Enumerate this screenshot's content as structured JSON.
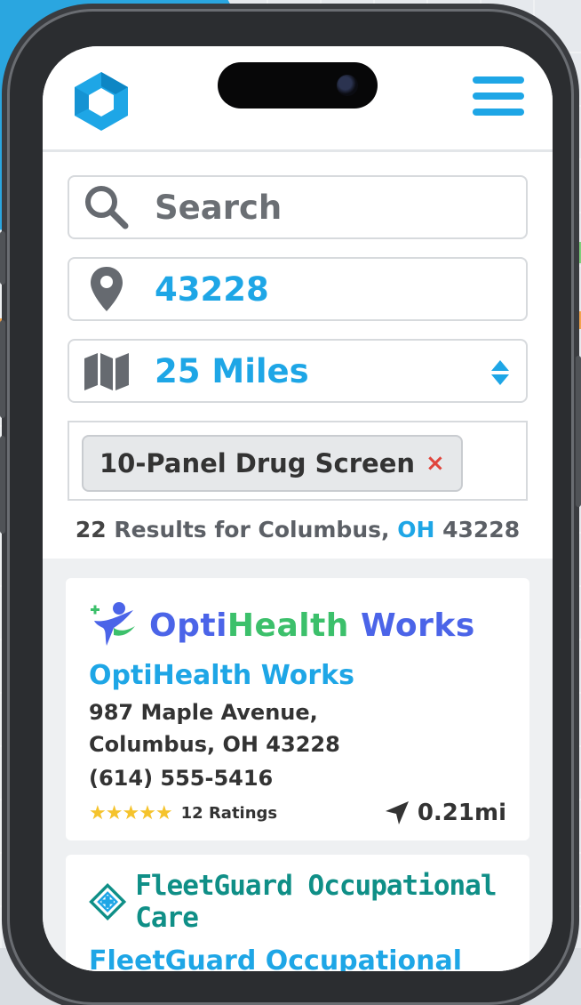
{
  "search": {
    "placeholder": "Search"
  },
  "location": {
    "value": "43228"
  },
  "radius": {
    "value": "25 Miles"
  },
  "filter_tag": {
    "label": "10-Panel Drug Screen",
    "remove": "×"
  },
  "results_summary": {
    "count": "22",
    "text": "Results for Columbus,",
    "state": "OH",
    "zip": "43228"
  },
  "results": [
    {
      "logo_word_part1": "Opti",
      "logo_word_part2": "Health",
      "logo_word_part3": " Works",
      "name": "OptiHealth Works",
      "address_line1": "987 Maple Avenue,",
      "address_line2": "Columbus, OH 43228",
      "phone": "(614) 555-5416",
      "rating_stars": 5,
      "ratings_text": "12 Ratings",
      "distance": "0.21mi"
    },
    {
      "logo_word": "FleetGuard Occupational Care",
      "name": "FleetGuard Occupational Care"
    }
  ],
  "colors": {
    "accent": "#1ea6e6",
    "opti_blue": "#4b64e8",
    "opti_green": "#3cc06b",
    "fleet_teal": "#0f8f87",
    "star": "#f5c32c"
  },
  "icons": {
    "logo": "hexagon-logo-icon",
    "menu": "hamburger-menu-icon",
    "search": "search-icon",
    "location": "map-pin-icon",
    "radius": "map-icon",
    "select": "updown-icon",
    "distance": "navigation-arrow-icon"
  }
}
